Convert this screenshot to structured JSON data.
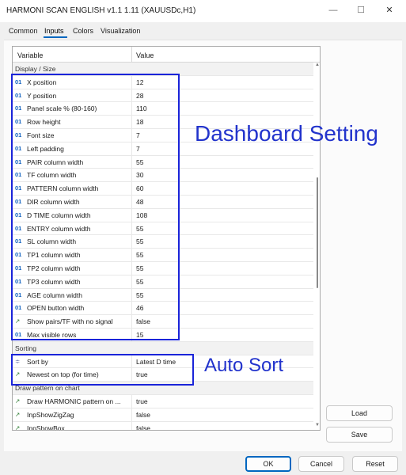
{
  "window": {
    "title": "HARMONI SCAN ENGLISH v1.1 1.11 (XAUUSDc,H1)",
    "minimize_glyph": "—",
    "maximize_glyph": "☐",
    "close_glyph": "✕"
  },
  "tabs": [
    {
      "label": "Common"
    },
    {
      "label": "Inputs"
    },
    {
      "label": "Colors"
    },
    {
      "label": "Visualization"
    }
  ],
  "active_tab": "Inputs",
  "grid": {
    "header": {
      "variable": "Variable",
      "value": "Value"
    },
    "rows": [
      {
        "type": "section",
        "label": "Display / Size"
      },
      {
        "type": "int",
        "icon": "01",
        "name": "X position",
        "value": "12"
      },
      {
        "type": "int",
        "icon": "01",
        "name": "Y position",
        "value": "28"
      },
      {
        "type": "int",
        "icon": "01",
        "name": "Panel scale % (80-160)",
        "value": "110"
      },
      {
        "type": "int",
        "icon": "01",
        "name": "Row height",
        "value": "18"
      },
      {
        "type": "int",
        "icon": "01",
        "name": "Font size",
        "value": "7"
      },
      {
        "type": "int",
        "icon": "01",
        "name": "Left padding",
        "value": "7"
      },
      {
        "type": "int",
        "icon": "01",
        "name": "PAIR column width",
        "value": "55"
      },
      {
        "type": "int",
        "icon": "01",
        "name": "TF column width",
        "value": "30"
      },
      {
        "type": "int",
        "icon": "01",
        "name": "PATTERN column width",
        "value": "60"
      },
      {
        "type": "int",
        "icon": "01",
        "name": "DIR column width",
        "value": "48"
      },
      {
        "type": "int",
        "icon": "01",
        "name": "D TIME column width",
        "value": "108"
      },
      {
        "type": "int",
        "icon": "01",
        "name": "ENTRY column width",
        "value": "55"
      },
      {
        "type": "int",
        "icon": "01",
        "name": "SL column width",
        "value": "55"
      },
      {
        "type": "int",
        "icon": "01",
        "name": "TP1 column width",
        "value": "55"
      },
      {
        "type": "int",
        "icon": "01",
        "name": "TP2 column width",
        "value": "55"
      },
      {
        "type": "int",
        "icon": "01",
        "name": "TP3 column width",
        "value": "55"
      },
      {
        "type": "int",
        "icon": "01",
        "name": "AGE column width",
        "value": "55"
      },
      {
        "type": "int",
        "icon": "01",
        "name": "OPEN button width",
        "value": "46"
      },
      {
        "type": "bool",
        "icon": "↗",
        "name": "Show pairs/TF with no signal",
        "value": "false"
      },
      {
        "type": "int",
        "icon": "01",
        "name": "Max visible rows",
        "value": "15"
      },
      {
        "type": "section",
        "label": "Sorting"
      },
      {
        "type": "enum",
        "icon": "≑",
        "name": "Sort by",
        "value": "Latest D time"
      },
      {
        "type": "bool",
        "icon": "↗",
        "name": "Newest on top (for time)",
        "value": "true"
      },
      {
        "type": "section",
        "label": "Draw pattern on chart"
      },
      {
        "type": "bool",
        "icon": "↗",
        "name": "Draw HARMONIC pattern on ...",
        "value": "true"
      },
      {
        "type": "bool",
        "icon": "↗",
        "name": "InpShowZigZag",
        "value": "false"
      },
      {
        "type": "bool",
        "icon": "↗",
        "name": "InpShowBox",
        "value": "false"
      }
    ]
  },
  "annotations": {
    "dashboard": "Dashboard Setting",
    "autosort": "Auto Sort",
    "color": "#1a24d9"
  },
  "side_buttons": {
    "load": "Load",
    "save": "Save"
  },
  "footer": {
    "ok": "OK",
    "cancel": "Cancel",
    "reset": "Reset"
  },
  "colors": {
    "accent": "#0067c0",
    "annotation": "#2233cc",
    "int_icon": "#1565c0",
    "bool_icon": "#2e7d32"
  }
}
